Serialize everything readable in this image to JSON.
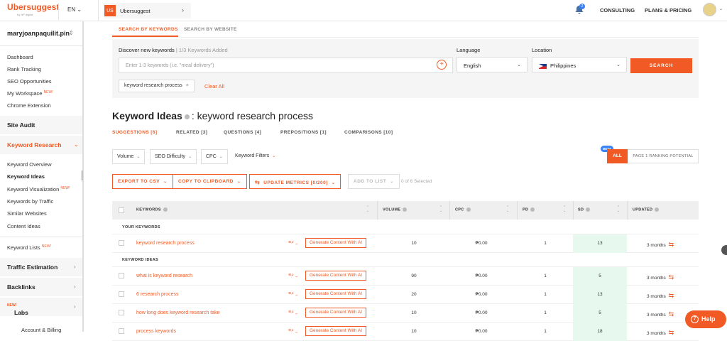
{
  "topbar": {
    "logo": "Ubersuggest",
    "logo_sub": "by NP digital",
    "language": "EN",
    "project_badge": "US",
    "project_name": "Ubersuggest",
    "notification_count": "2",
    "consulting": "CONSULTING",
    "plans": "PLANS & PRICING"
  },
  "sidebar": {
    "username": "maryjoanpaquilit.pin",
    "items_top": [
      "Dashboard",
      "Rank Tracking",
      "SEO Opportunities",
      "My Workspace",
      "Chrome Extension"
    ],
    "new_label": "NEW!",
    "site_audit": "Site Audit",
    "keyword_research": "Keyword Research",
    "kr_items": [
      "Keyword Overview",
      "Keyword Ideas",
      "Keyword Visualization",
      "Keywords by Traffic",
      "Similar Websites",
      "Content Ideas"
    ],
    "keyword_lists": "Keyword Lists",
    "traffic_estimation": "Traffic Estimation",
    "backlinks": "Backlinks",
    "labs": "Labs",
    "account_billing": "Account & Billing"
  },
  "main": {
    "tabs": [
      "SEARCH BY KEYWORDS",
      "SEARCH BY WEBSITE"
    ],
    "discover_label": "Discover new keywords",
    "keywords_added": "1/3 Keywords Added",
    "keyword_placeholder": "Enter 1-3 keywords (i.e. \"meal delivery\")",
    "language_label": "Language",
    "language_value": "English",
    "location_label": "Location",
    "location_value": "Philippines",
    "search_button": "SEARCH",
    "chip": "keyword research process",
    "clear_all": "Clear All",
    "title_prefix": "Keyword Ideas",
    "title_suffix": ": keyword research process",
    "subtabs": [
      "SUGGESTIONS [6]",
      "RELATED [3]",
      "QUESTIONS [4]",
      "PREPOSITIONS [1]",
      "COMPARISONS [10]"
    ],
    "filters": [
      "Volume",
      "SEO Difficulty",
      "CPC",
      "Keyword Filters"
    ],
    "beta": "BETA",
    "all": "ALL",
    "page1": "PAGE 1 RANKING POTENTIAL",
    "export_csv": "EXPORT TO CSV",
    "copy_clipboard": "COPY TO CLIPBOARD",
    "update_metrics": "UPDATE METRICS [0/200]",
    "add_to_list": "ADD TO LIST",
    "selected_count": "0 of 6 Selected"
  },
  "table": {
    "headers": [
      "KEYWORDS",
      "VOLUME",
      "CPC",
      "PD",
      "SD",
      "UPDATED"
    ],
    "your_keywords": "YOUR KEYWORDS",
    "keyword_ideas": "KEYWORD IDEAS",
    "ai_button": "Generate Content With AI",
    "your_rows": [
      {
        "keyword": "keyword research process",
        "volume": "10",
        "cpc": "₱0.00",
        "pd": "1",
        "sd": "13",
        "updated": "3 months"
      }
    ],
    "idea_rows": [
      {
        "keyword": "what is keyword research",
        "volume": "90",
        "cpc": "₱0.00",
        "pd": "1",
        "sd": "5",
        "updated": "3 months"
      },
      {
        "keyword": "6 research process",
        "volume": "20",
        "cpc": "₱0.00",
        "pd": "1",
        "sd": "13",
        "updated": "3 months"
      },
      {
        "keyword": "how long does keyword research take",
        "volume": "10",
        "cpc": "₱0.00",
        "pd": "1",
        "sd": "5",
        "updated": "3 months"
      },
      {
        "keyword": "process keywords",
        "volume": "10",
        "cpc": "₱0.00",
        "pd": "1",
        "sd": "18",
        "updated": "3 months"
      }
    ]
  },
  "help": "Help",
  "colors": {
    "accent": "#f15a24",
    "sd_green": "#e7f8ef",
    "beta_blue": "#3b82f6"
  }
}
